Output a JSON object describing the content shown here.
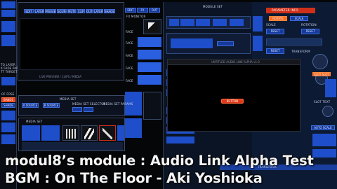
{
  "left_panel": {
    "labels": [
      "TO LAYER",
      "X FADE PARK",
      "TT TARGET"
    ],
    "bottom_label": "OF FOSE",
    "bottom_btn": "BANDS",
    "bottom_btn2": "SHADE"
  },
  "preview": {
    "top_tabs": [
      "EDIT",
      "LAYER",
      "PREVIEW",
      "SOUND",
      "MUTE",
      "CLIP",
      "OUT",
      "LAYER",
      "SHADER"
    ],
    "footer": "LIVE PREVIEW / CLIPS / MEDIA"
  },
  "mid_col": {
    "top_buttons": [
      "EDIT",
      "FX",
      "OUT"
    ],
    "label": "FX MONITOR",
    "face_labels": [
      "FACE",
      "FACE",
      "FACE",
      "FACE",
      "FACE"
    ]
  },
  "media_window": {
    "title": "MEDIA SET",
    "buttons": [
      "A SOURCE",
      "B SOURCE"
    ],
    "sub_title": "MEDIA SET SELECTOR",
    "right_label": "MEDIA SET PARAMS"
  },
  "bottom_strip": {
    "title": "MEDIA SET"
  },
  "right_area": {
    "title": "MODULE SET",
    "sub_title": "PARAMETER INFO",
    "tabs": [
      "ROTATE",
      "SCALE"
    ],
    "buttons": [
      "RESET",
      "RESET",
      "RESET"
    ],
    "labels": [
      "SCALE",
      "ROTATION",
      "TRANSFORM",
      "SLOT SLOT",
      "SLOT TEXT"
    ],
    "auto_label": "AUTO SCALE",
    "bottom_label": "TRANSFORM"
  },
  "modal": {
    "title": "UNTITLED AUDIO LINK ALPHA v1.0",
    "button": "BUTTON"
  },
  "caption": {
    "line1": "modul8’s module : Audio Link Alpha Test",
    "line2": "BGM : On The Floor - Aki Yoshioka"
  },
  "colors": {
    "accent_blue": "#1e4ec9",
    "accent_orange": "#ff6a1a",
    "accent_red": "#d0301a"
  }
}
